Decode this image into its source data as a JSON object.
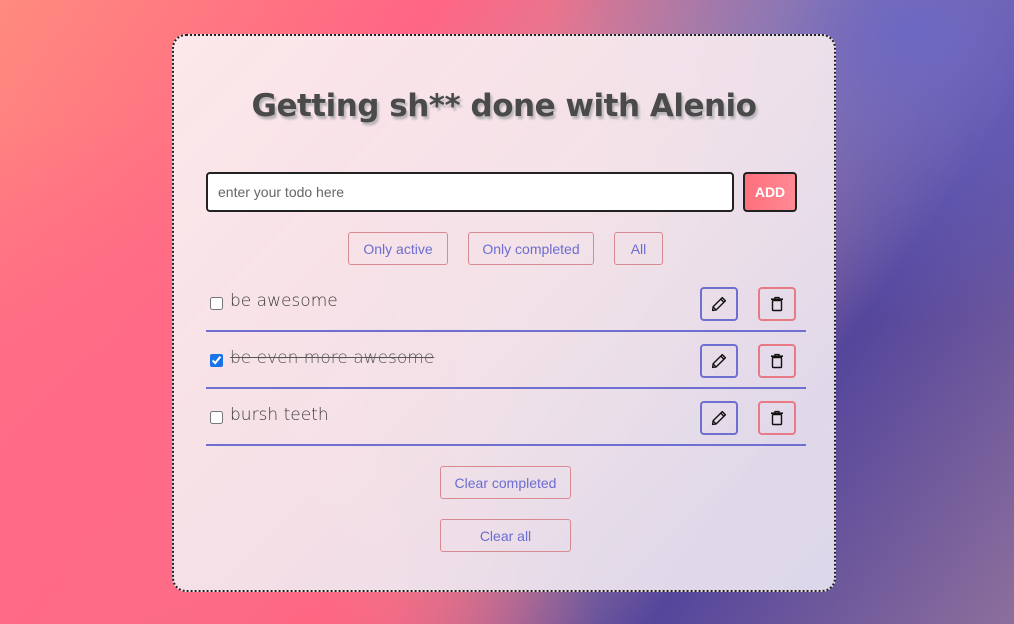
{
  "app": {
    "title": "Getting sh** done with Alenio"
  },
  "input": {
    "placeholder": "enter your todo here",
    "value": "",
    "add_label": "ADD"
  },
  "filters": [
    {
      "label": "Only active"
    },
    {
      "label": "Only completed"
    },
    {
      "label": "All"
    }
  ],
  "todos": [
    {
      "text": "be awesome",
      "completed": false
    },
    {
      "text": "be even more awesome",
      "completed": true
    },
    {
      "text": "bursh teeth",
      "completed": false
    }
  ],
  "icons": {
    "edit": "pencil-icon",
    "delete": "trash-icon"
  },
  "actions": {
    "clear_completed_label": "Clear completed",
    "clear_all_label": "Clear all"
  },
  "colors": {
    "accent_blue": "#6e6fd0",
    "accent_pink": "#ff6f7c",
    "checkbox": "#1a73e8"
  }
}
